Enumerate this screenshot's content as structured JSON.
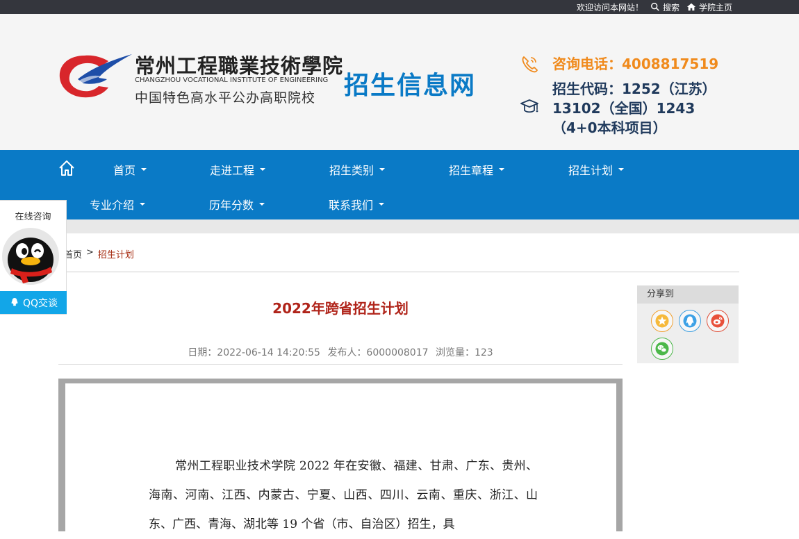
{
  "topbar": {
    "welcome": "欢迎访问本网站！",
    "search_label": "搜索",
    "home_label": "学院主页"
  },
  "header": {
    "logo_cn": "常州工程職業技術學院",
    "logo_en": "CHANGZHOU VOCATIONAL INSTITUTE OF ENGINEERING",
    "logo_slogan": "中国特色高水平公办高职院校",
    "site_title": "招生信息网",
    "phone_text": "咨询电话：4008817519",
    "code_text": "招生代码：1252（江苏）13102（全国）1243（4+0本科项目）"
  },
  "nav": {
    "items": [
      {
        "label": "首页"
      },
      {
        "label": "走进工程"
      },
      {
        "label": "招生类别"
      },
      {
        "label": "招生章程"
      },
      {
        "label": "招生计划"
      },
      {
        "label": "专业介绍"
      },
      {
        "label": "历年分数"
      },
      {
        "label": "联系我们"
      }
    ]
  },
  "breadcrumb": {
    "home": "首页",
    "sep": ">",
    "current": "招生计划"
  },
  "article": {
    "title": "2022年跨省招生计划",
    "date": "日期：2022-06-14 14:20:55",
    "author": "发布人：6000008017",
    "views": "浏览量：123",
    "body": "常州工程职业技术学院 2022 年在安徽、福建、甘肃、广东、贵州、海南、河南、江西、内蒙古、宁夏、山西、四川、云南、重庆、浙江、山东、广西、青海、湖北等 19 个省（市、自治区）招生，具"
  },
  "share": {
    "title": "分享到",
    "icons": [
      "favorite-icon",
      "qq-icon",
      "weibo-icon",
      "wechat-icon"
    ]
  },
  "consult": {
    "title": "在线咨询",
    "button_label": "QQ交谈"
  },
  "colors": {
    "nav_blue": "#0a7ac6",
    "title_red": "#b0241a",
    "phone_orange": "#f08a1c",
    "qq_blue": "#12a6e8"
  }
}
